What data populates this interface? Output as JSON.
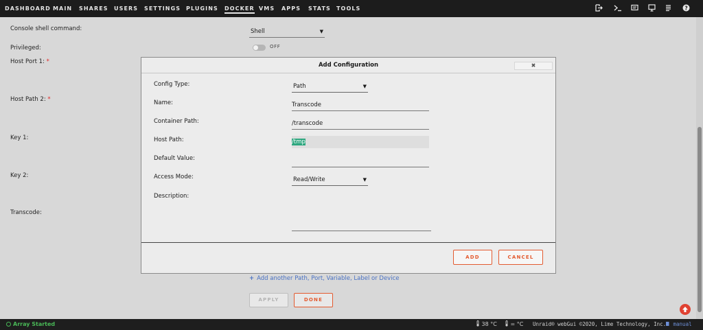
{
  "nav": {
    "items": [
      {
        "label": "DASHBOARD",
        "active": false
      },
      {
        "label": "MAIN",
        "active": false
      },
      {
        "label": "SHARES",
        "active": false
      },
      {
        "label": "USERS",
        "active": false
      },
      {
        "label": "SETTINGS",
        "active": false
      },
      {
        "label": "PLUGINS",
        "active": false
      },
      {
        "label": "DOCKER",
        "active": true
      },
      {
        "label": "VMS",
        "active": false
      },
      {
        "label": "APPS",
        "active": false
      },
      {
        "label": "STATS",
        "active": false
      },
      {
        "label": "TOOLS",
        "active": false
      }
    ],
    "icons": [
      "logout-icon",
      "terminal-icon",
      "feedback-icon",
      "monitor-icon",
      "log-icon",
      "help-icon"
    ]
  },
  "background_form": {
    "console_label": "Console shell command:",
    "console_value": "Shell",
    "privileged_label": "Privileged:",
    "privileged_state": "OFF",
    "host_port_1_label": "Host Port 1: ",
    "host_path_2_label": "Host Path 2: ",
    "required_mark": "*",
    "key_1_label": "Key 1:",
    "key_2_label": "Key 2:",
    "transcode_label": "Transcode:",
    "add_link": "Add another Path, Port, Variable, Label or Device",
    "apply_label": "APPLY",
    "done_label": "DONE"
  },
  "modal": {
    "title": "Add Configuration",
    "close_glyph": "✖",
    "config_type_label": "Config Type:",
    "config_type_value": "Path",
    "name_label": "Name:",
    "name_value": "Transcode",
    "container_path_label": "Container Path:",
    "container_path_value": "/transcode",
    "host_path_label": "Host Path:",
    "host_path_value": "/tmp",
    "default_value_label": "Default Value:",
    "default_value_value": "",
    "access_mode_label": "Access Mode:",
    "access_mode_value": "Read/Write",
    "description_label": "Description:",
    "add_label": "ADD",
    "cancel_label": "CANCEL"
  },
  "footer": {
    "status": "Array Started",
    "cpu_temp": "38 °C",
    "mb_temp": "= °C",
    "copyright": "Unraid® webGui ©2020, Lime Technology, Inc.",
    "manual": "manual"
  },
  "colors": {
    "nav_bg": "#1c1c1c",
    "accent": "#e35a2f",
    "status_green": "#49b857",
    "link_blue": "#4a72c4",
    "selection": "#2ea77f"
  }
}
